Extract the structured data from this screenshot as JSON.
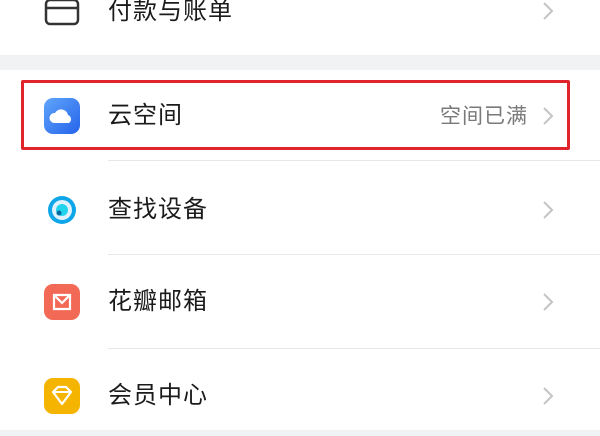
{
  "top_row": {
    "label": "付款与账单",
    "icon": "wallet-card-icon"
  },
  "items": [
    {
      "label": "云空间",
      "value": "空间已满",
      "icon": "cloud-icon",
      "highlighted": true
    },
    {
      "label": "查找设备",
      "value": "",
      "icon": "find-device-icon"
    },
    {
      "label": "花瓣邮箱",
      "value": "",
      "icon": "mail-icon"
    },
    {
      "label": "会员中心",
      "value": "",
      "icon": "member-diamond-icon"
    }
  ],
  "colors": {
    "highlight_border": "#e0242b",
    "background": "#f1f2f4",
    "cloud_icon": "#3b82f6",
    "mail_icon": "#f26a55",
    "member_icon": "#f5b400"
  }
}
